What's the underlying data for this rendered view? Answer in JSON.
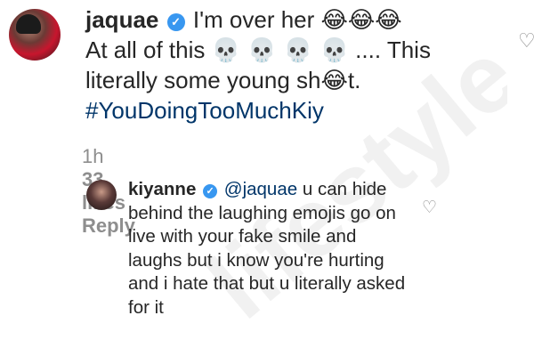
{
  "comment_main": {
    "username": "jaquae",
    "verified_icon": "verified-badge-icon",
    "line1_text": "I'm over her",
    "line1_emojis": "😂😂😂",
    "line2_text": "At all of this",
    "line2_emojis": "💀 💀 💀 💀",
    "line2_tail": ".... This",
    "line3_text_a": "literally some young sh",
    "line3_emoji": "😂",
    "line3_text_b": "t.",
    "hashtag": "#YouDoingTooMuchKiy",
    "time": "1h",
    "likes": "33 likes",
    "reply_label": "Reply",
    "like_icon": "heart-outline-icon"
  },
  "reply": {
    "username": "kiyanne",
    "verified_icon": "verified-badge-icon",
    "mention": "@jaquae",
    "text": "u can hide behind the laughing emojis go on live with your fake smile and laughs but i know you're hurting and i hate that but u literally asked for it",
    "like_icon": "heart-outline-icon"
  },
  "watermark": {
    "text": "lifestyle"
  },
  "colors": {
    "text": "#262626",
    "meta": "#8e8e8e",
    "link": "#003569",
    "verified": "#3897f0"
  }
}
